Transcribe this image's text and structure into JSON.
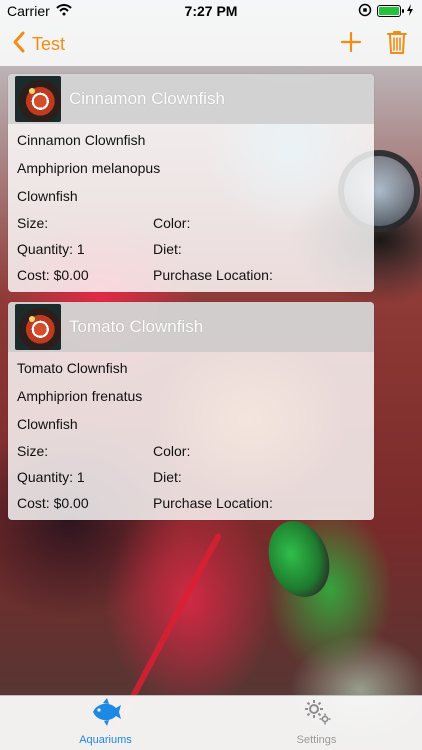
{
  "status": {
    "carrier": "Carrier",
    "time": "7:27 PM",
    "battery_color": "#22c33b"
  },
  "nav": {
    "back_label": "Test",
    "accent": "#f28c14",
    "icons": [
      "chevron-left-icon",
      "plus-icon",
      "trash-icon"
    ]
  },
  "cards": [
    {
      "title": "Cinnamon Clownfish",
      "common_name": "Cinnamon Clownfish",
      "scientific_name": "Amphiprion melanopus",
      "category": "Clownfish",
      "size_label": "Size:",
      "color_label": "Color:",
      "quantity": "Quantity: 1",
      "diet_label": "Diet:",
      "cost": "Cost: $0.00",
      "purchase_location_label": "Purchase Location:"
    },
    {
      "title": "Tomato Clownfish",
      "common_name": "Tomato Clownfish",
      "scientific_name": "Amphiprion frenatus",
      "category": "Clownfish",
      "size_label": "Size:",
      "color_label": "Color:",
      "quantity": "Quantity: 1",
      "diet_label": "Diet:",
      "cost": "Cost: $0.00",
      "purchase_location_label": "Purchase Location:"
    }
  ],
  "tabs": [
    {
      "label": "Aquariums",
      "icon": "fish-icon",
      "active": true
    },
    {
      "label": "Settings",
      "icon": "gear-icon",
      "active": false
    }
  ],
  "colors": {
    "tab_active": "#1e88e5",
    "tab_inactive": "#9a9a9a"
  }
}
